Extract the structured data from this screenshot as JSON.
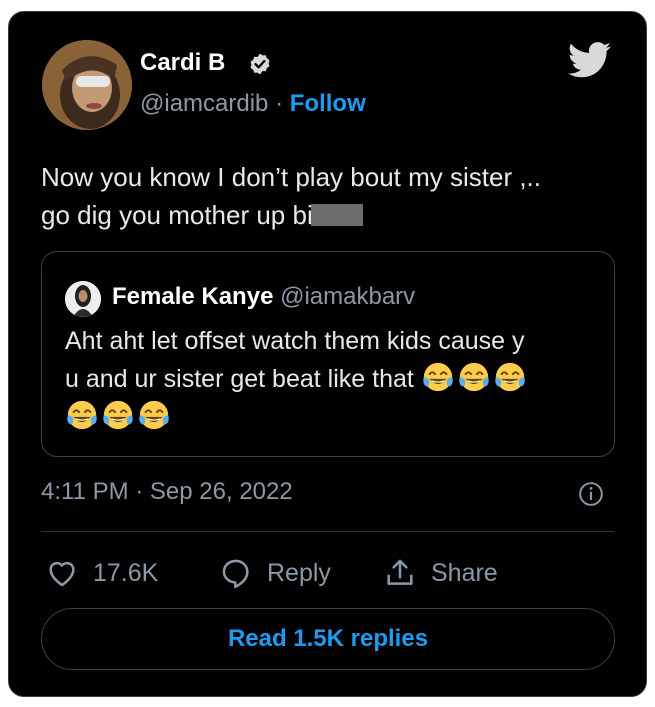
{
  "tweet": {
    "author_name": "Cardi B",
    "author_handle": "@iamcardib",
    "separator": "·",
    "follow_label": "Follow",
    "text_line1": "Now you know I don’t play bout my sister ,..",
    "text_line2": "go dig you mother up bi",
    "timestamp": "4:11 PM · Sep 26, 2022"
  },
  "quote": {
    "author_name": "Female Kanye",
    "author_handle": "@iamakbarv",
    "text_line1": "Aht aht let offset watch them kids cause y",
    "text_line2": "u and ur sister get beat like that",
    "emoji_name": "face-with-tears-of-joy"
  },
  "actions": {
    "like_count": "17.6K",
    "reply_label": "Reply",
    "share_label": "Share",
    "read_replies_label": "Read 1.5K replies"
  },
  "colors": {
    "background": "#000000",
    "accent": "#1d9bf0",
    "secondary_text": "#8b98a5",
    "primary_text": "#e7e9ea"
  }
}
